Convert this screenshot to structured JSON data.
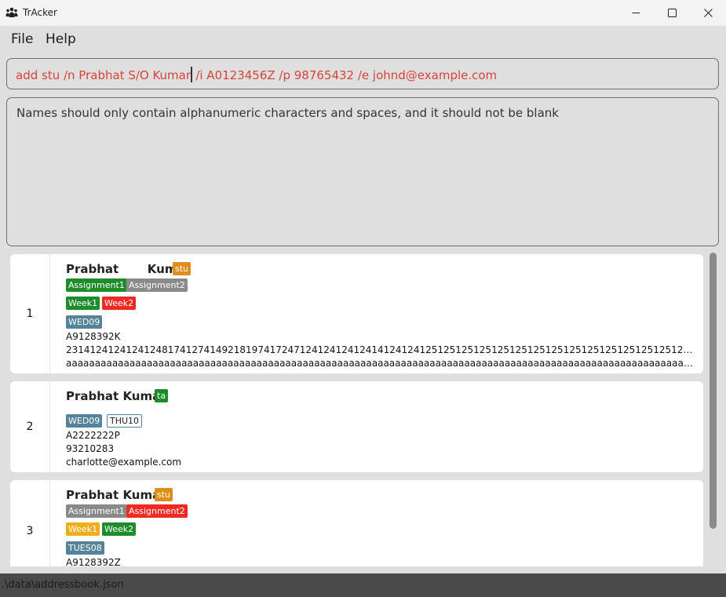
{
  "window": {
    "title": "TrAcker",
    "app_icon": "people-group-icon"
  },
  "menu": {
    "file": "File",
    "help": "Help"
  },
  "command": {
    "value": "add stu /n Prabhat S/O Kumar",
    "value_rest": "/i A0123456Z /p 98765432 /e johnd@example.com"
  },
  "result": {
    "message": "Names should only contain alphanumeric characters and spaces, and it should not be blank"
  },
  "persons": [
    {
      "index": "1",
      "name": "Prabhat       Kumar",
      "role": "stu",
      "assignments": [
        "Assignment1",
        "Assignment2"
      ],
      "weeks": [
        "Week1",
        "Week2"
      ],
      "tutorials": [
        "WED09"
      ],
      "id": "A9128392K",
      "phone": "23141241241241248174127414921819741724712412412412414124124125125125125125125125125125125125125125125125125125123214152198...",
      "email": "aaaaaaaaaaaaaaaaaaaaaaaaaaaaaaaaaaaaaaaaaaaaaaaaaaaaaaaaaaaaaaaaaaaaaaaaaaaaaaaaaaaaaaaaaaaaaaaaaaaaaaaaaaaaaaa..."
    },
    {
      "index": "2",
      "name": "Prabhat Kumar",
      "role": "ta",
      "tutorials": [
        "WED09",
        "THU10"
      ],
      "id": "A2222222P",
      "phone": "93210283",
      "email": "charlotte@example.com"
    },
    {
      "index": "3",
      "name": "Prabhat Kumar",
      "role": "stu",
      "assignments": [
        "Assignment1",
        "Assignment2"
      ],
      "weeks": [
        "Week1",
        "Week2"
      ],
      "tutorials": [
        "TUES08"
      ],
      "id": "A9128392Z"
    }
  ],
  "status": {
    "path": ".\\data\\addressbook.json"
  },
  "colors": {
    "command_error": "#d9423b",
    "orange": "#e08e1b",
    "green": "#1f8c2c",
    "grey": "#8a8a8a",
    "red": "#ee2a24",
    "teal": "#54839a",
    "yellow": "#f2ad1d"
  }
}
